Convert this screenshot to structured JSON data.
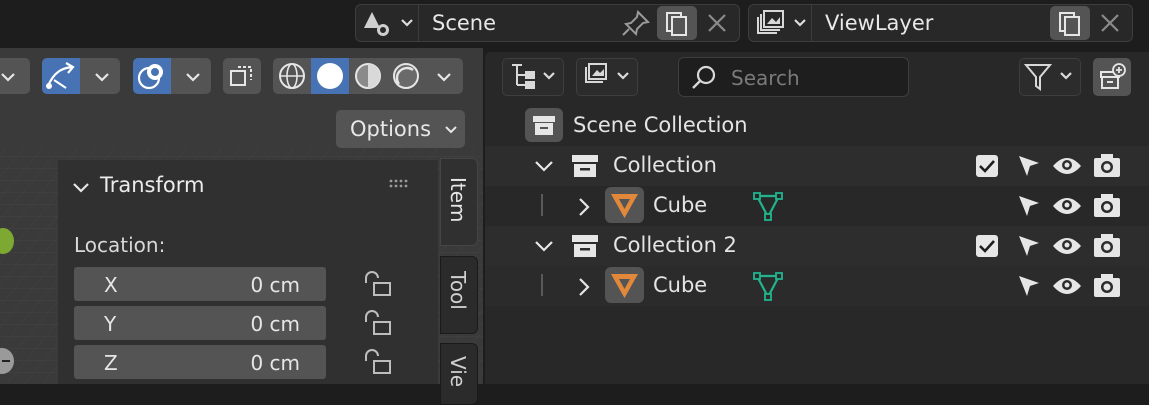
{
  "header": {
    "scene_name": "Scene",
    "view_layer_name": "ViewLayer"
  },
  "viewport": {
    "options_label": "Options",
    "panel_title": "Transform",
    "location_label": "Location:",
    "location": [
      {
        "axis": "X",
        "value": "0 cm"
      },
      {
        "axis": "Y",
        "value": "0 cm"
      },
      {
        "axis": "Z",
        "value": "0 cm"
      }
    ],
    "tabs": [
      "Item",
      "Tool",
      "Vie"
    ]
  },
  "outliner": {
    "search_placeholder": "Search",
    "scene_collection_label": "Scene Collection",
    "collections": [
      {
        "name": "Collection",
        "child": "Cube"
      },
      {
        "name": "Collection 2",
        "child": "Cube"
      }
    ]
  },
  "colors": {
    "accent_blue": "#4772b3",
    "mesh_orange": "#e1883b",
    "vertex_green": "#21b58f",
    "panel_bg": "#303030"
  }
}
